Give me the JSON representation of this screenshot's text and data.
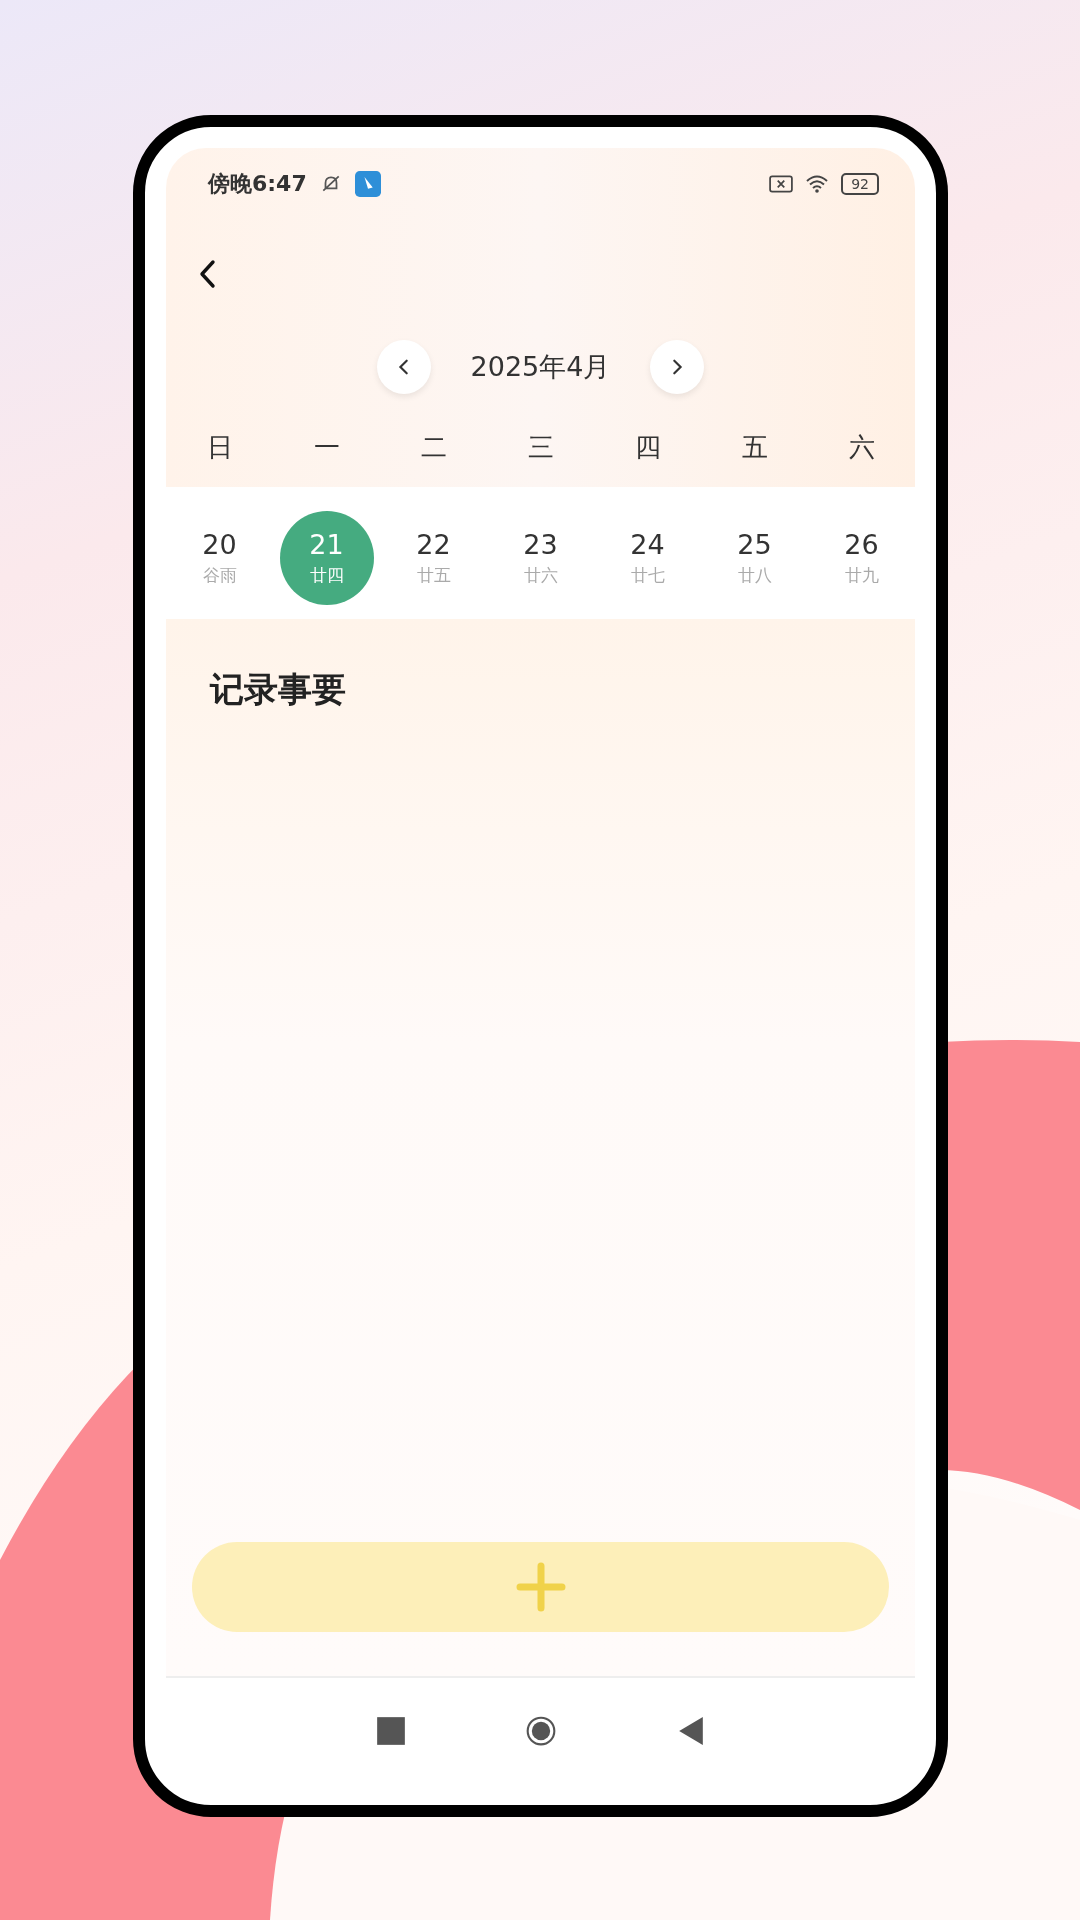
{
  "status_bar": {
    "time": "傍晚6:47",
    "battery": "92"
  },
  "calendar": {
    "month": "2025年4月",
    "weekdays": [
      "日",
      "一",
      "二",
      "三",
      "四",
      "五",
      "六"
    ],
    "dates": [
      {
        "day": "20",
        "lunar": "谷雨",
        "selected": false
      },
      {
        "day": "21",
        "lunar": "廿四",
        "selected": true
      },
      {
        "day": "22",
        "lunar": "廿五",
        "selected": false
      },
      {
        "day": "23",
        "lunar": "廿六",
        "selected": false
      },
      {
        "day": "24",
        "lunar": "廿七",
        "selected": false
      },
      {
        "day": "25",
        "lunar": "廿八",
        "selected": false
      },
      {
        "day": "26",
        "lunar": "廿九",
        "selected": false
      }
    ]
  },
  "section_title": "记录事要"
}
